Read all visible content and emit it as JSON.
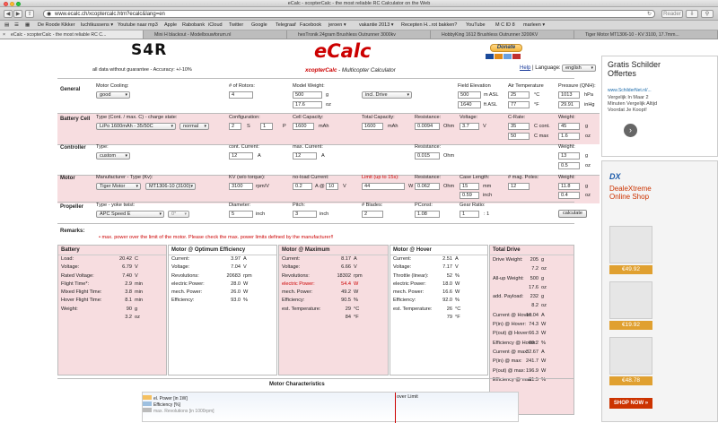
{
  "window_title": "eCalc - xcopterCalc - the most reliable RC Calculator on the Web",
  "browser": {
    "url": "www.ecalc.ch/xcoptercalc.htm?ecalc&lang=en",
    "reader_label": "Reader",
    "bookmarks": [
      "De Roode Kikker",
      "luchtkussens ▾",
      "Youtube naar mp3",
      "Apple",
      "Rabobank",
      "iCloud",
      "Twitter",
      "Google",
      "Telegraaf",
      "Facebook",
      "jeroen ▾",
      "vakantie 2013 ▾",
      "Recepten H...rot bakken?",
      "YouTube",
      "M C ID 8",
      "marleen ▾"
    ],
    "tabs": [
      "eCalc - xcopterCalc - the most reliable RC C...",
      "Mini H blackout - Modelbouwforum.nl",
      "hexTronik 24gram Brushless Outrunner 3000kv",
      "HobbyKing 1612 Brushless Outrunner 3200KV",
      "Tiger Motor MT1306-10 - KV 3100, 17.7mm..."
    ]
  },
  "header": {
    "logo_text": "S4R",
    "ecalc_logo": "eCalc",
    "disclaimer": "all data without guarantee - Accuracy: +/-10%",
    "subtitle_brand": "xcopterCalc",
    "subtitle": " - Multicopter Calculator",
    "donate_label": "Donate",
    "help_label": "Help",
    "language_label": "| Language:",
    "language_value": "english"
  },
  "general": {
    "title": "General",
    "motor_cooling_label": "Motor Cooling:",
    "motor_cooling": "good",
    "rotors_label": "# of Rotors:",
    "rotors": "4",
    "model_weight_label": "Model Weight:",
    "model_weight": "500",
    "model_weight_unit": "g",
    "model_weight_oz": "17.6",
    "model_weight_oz_unit": "oz",
    "drive_incl": "incl. Drive",
    "field_elev_label": "Field Elevation",
    "field_elev": "500",
    "field_elev_unit": "m ASL",
    "field_elev_ft": "1640",
    "field_elev_ft_unit": "ft ASL",
    "air_temp_label": "Air Temperature",
    "air_temp_c": "25",
    "air_temp_c_unit": "°C",
    "air_temp_f": "77",
    "air_temp_f_unit": "°F",
    "pressure_label": "Pressure (QNH):",
    "pressure": "1013",
    "pressure_unit": "hPa",
    "pressure_inhg": "29.91",
    "pressure_inhg_unit": "inHg"
  },
  "battery": {
    "title": "Battery Cell",
    "type_label": "Type (Cont. / max. C) - charge state:",
    "type": "LiPo 1600mAh - 35/50C",
    "charge": "normal",
    "config_label": "Configuration:",
    "config_s": "2",
    "config_s_unit": "S",
    "config_p": "1",
    "config_p_unit": "P",
    "cell_cap_label": "Cell Capacity:",
    "cell_cap": "1600",
    "cell_cap_unit": "mAh",
    "total_cap_label": "Total Capacity:",
    "total_cap": "1600",
    "total_cap_unit": "mAh",
    "resistance_label": "Resistance:",
    "resistance": "0.0094",
    "resistance_unit": "Ohm",
    "voltage_label": "Voltage:",
    "voltage": "3.7",
    "voltage_unit": "V",
    "crate_label": "C-Rate:",
    "crate_cont": "35",
    "crate_cont_unit": "C cont.",
    "crate_max": "50",
    "crate_max_unit": "C max",
    "weight_label": "Weight:",
    "weight": "45",
    "weight_unit": "g",
    "weight_oz": "1.6",
    "weight_oz_unit": "oz"
  },
  "controller": {
    "title": "Controller",
    "type_label": "Type:",
    "type": "custom",
    "cont_current_label": "cont. Current:",
    "cont_current": "12",
    "cont_current_unit": "A",
    "max_current_label": "max. Current:",
    "max_current": "12",
    "max_current_unit": "A",
    "resistance_label": "Resistance:",
    "resistance": "0.015",
    "resistance_unit": "Ohm",
    "weight_label": "Weight:",
    "weight": "13",
    "weight_unit": "g",
    "weight_oz": "0.5",
    "weight_oz_unit": "oz"
  },
  "motor": {
    "title": "Motor",
    "manufacturer_label": "Manufacturer - Type (Kv):",
    "manufacturer": "Tiger Motor",
    "type": "MT1306-10 (3100)",
    "kv_label": "KV (w/o torque):",
    "kv": "3100",
    "kv_unit": "rpm/V",
    "noload_label": "no-load Current:",
    "noload_current": "0.2",
    "noload_current_unit": "A @",
    "noload_voltage": "10",
    "noload_voltage_unit": "V",
    "limit_label": "Limit (up to 15s):",
    "limit": "44",
    "limit_unit": "W",
    "resistance_label": "Resistance:",
    "resistance": "0.062",
    "resistance_unit": "Ohm",
    "case_length_label": "Case Length:",
    "case_length": "15",
    "case_length_unit": "mm",
    "case_length_in": "0.59",
    "case_length_in_unit": "inch",
    "poles_label": "# mag. Poles:",
    "poles": "12",
    "weight_label": "Weight:",
    "weight": "11.8",
    "weight_unit": "g",
    "weight_oz": "0.4",
    "weight_oz_unit": "oz"
  },
  "propeller": {
    "title": "Propeller",
    "type_label": "Type - yoke twist:",
    "type": "APC Speed E",
    "twist": "0°",
    "diameter_label": "Diameter:",
    "diameter": "5",
    "diameter_unit": "inch",
    "pitch_label": "Pitch:",
    "pitch": "3",
    "pitch_unit": "inch",
    "blades_label": "# Blades:",
    "blades": "2",
    "pconst_label": "PConst:",
    "pconst": "1.08",
    "gear_label": "Gear Ratio:",
    "gear": "1",
    "gear_unit": ": 1",
    "calculate_label": "calculate"
  },
  "remarks": {
    "title": "Remarks:",
    "text": "max. power over the limit of the motor. Please check the max. power limits defined by the manufacturer!!"
  },
  "results": {
    "battery": {
      "title": "Battery",
      "rows": [
        [
          "Load:",
          "20.42",
          "C"
        ],
        [
          "Voltage:",
          "6.79",
          "V"
        ],
        [
          "Rated Voltage:",
          "7.40",
          "V"
        ],
        [
          "Flight Time*:",
          "2.9",
          "min"
        ],
        [
          "Mixed Flight Time:",
          "3.8",
          "min"
        ],
        [
          "Hover Flight Time:",
          "8.1",
          "min"
        ],
        [
          "Weight:",
          "90",
          "g"
        ],
        [
          "",
          "3.2",
          "oz"
        ]
      ]
    },
    "optimum": {
      "title": "Motor @ Optimum Efficiency",
      "rows": [
        [
          "Current:",
          "3.97",
          "A"
        ],
        [
          "Voltage:",
          "7.04",
          "V"
        ],
        [
          "Revolutions:",
          "20683",
          "rpm"
        ],
        [
          "electric Power:",
          "28.0",
          "W"
        ],
        [
          "mech. Power:",
          "26.0",
          "W"
        ],
        [
          "Efficiency:",
          "93.0",
          "%"
        ]
      ]
    },
    "maximum": {
      "title": "Motor @ Maximum",
      "rows": [
        [
          "Current:",
          "8.17",
          "A"
        ],
        [
          "Voltage:",
          "6.66",
          "V"
        ],
        [
          "Revolutions:",
          "18302",
          "rpm"
        ],
        [
          "electric Power:",
          "54.4",
          "W"
        ],
        [
          "mech. Power:",
          "49.2",
          "W"
        ],
        [
          "Efficiency:",
          "90.5",
          "%"
        ],
        [
          "est. Temperature:",
          "29",
          "°C"
        ],
        [
          "",
          "84",
          "°F"
        ]
      ]
    },
    "hover": {
      "title": "Motor @ Hover",
      "rows": [
        [
          "Current:",
          "2.51",
          "A"
        ],
        [
          "Voltage:",
          "7.17",
          "V"
        ],
        [
          "Throttle (linear):",
          "52",
          "%"
        ],
        [
          "electric Power:",
          "18.0",
          "W"
        ],
        [
          "mech. Power:",
          "16.6",
          "W"
        ],
        [
          "Efficiency:",
          "92.0",
          "%"
        ],
        [
          "est. Temperature:",
          "26",
          "°C"
        ],
        [
          "",
          "79",
          "°F"
        ]
      ]
    },
    "total": {
      "title": "Total Drive",
      "rows": [
        [
          "Drive Weight:",
          "205",
          "g"
        ],
        [
          "",
          "7.2",
          "oz"
        ],
        [
          "All-up Weight:",
          "500",
          "g"
        ],
        [
          "",
          "17.6",
          "oz"
        ],
        [
          "add. Payload:",
          "232",
          "g"
        ],
        [
          "",
          "8.2",
          "oz"
        ],
        [
          "Current @ Hover:",
          "10.04",
          "A"
        ],
        [
          "P(in) @ Hover:",
          "74.3",
          "W"
        ],
        [
          "P(out) @ Hover:",
          "66.3",
          "W"
        ],
        [
          "Efficiency @ Hover:",
          "89.2",
          "%"
        ],
        [
          "Current @ max:",
          "32.67",
          "A"
        ],
        [
          "P(in) @ max:",
          "241.7",
          "W"
        ],
        [
          "P(out) @ max:",
          "196.9",
          "W"
        ],
        [
          "Efficiency @ max:",
          "81.5",
          "%"
        ]
      ]
    }
  },
  "chart": {
    "title": "Motor Characteristics",
    "legend": [
      "el. Power [in 1W]",
      "Efficiency [%]",
      "max. Revolutions [in 1000rpm]"
    ],
    "annotation": "over Limit"
  },
  "ads": {
    "top_title": "Gratis Schilder Offertes",
    "top_url": "www.SchilderNet.nl/...",
    "top_text": "Vergelijk In Maar 2 Minuten Vergelijk Altijd Voordat Je Koopt!",
    "dx_brand": "DX",
    "dx_title": "DealeXtreme Online Shop",
    "prices": [
      "€49.92",
      "€19.92",
      "€48.78"
    ],
    "shop_now": "SHOP NOW »"
  },
  "colors": {
    "accent": "#cc0000",
    "pink": "#f7dde0",
    "donate": "#f5b53a"
  }
}
